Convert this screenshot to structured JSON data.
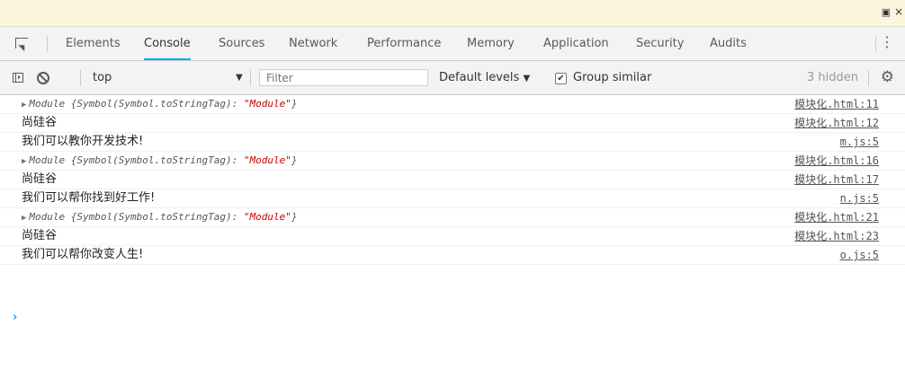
{
  "window": {
    "undock_icon": "undock-icon",
    "close_glyph": "×"
  },
  "tabs": [
    {
      "label": "Elements",
      "active": false
    },
    {
      "label": "Console",
      "active": true
    },
    {
      "label": "Sources",
      "active": false
    },
    {
      "label": "Network",
      "active": false
    },
    {
      "label": "Performance",
      "active": false
    },
    {
      "label": "Memory",
      "active": false
    },
    {
      "label": "Application",
      "active": false
    },
    {
      "label": "Security",
      "active": false
    },
    {
      "label": "Audits",
      "active": false
    }
  ],
  "toolbar": {
    "context": "top",
    "filter_placeholder": "Filter",
    "levels": "Default levels",
    "group_similar": "Group similar",
    "group_similar_checked": true,
    "hidden": "3 hidden"
  },
  "messages": [
    {
      "type": "object",
      "prefix": "Module {Symbol(Symbol.toStringTag): ",
      "value": "\"Module\"",
      "suffix": "}",
      "source": "模块化.html:11"
    },
    {
      "type": "text",
      "text": "尚硅谷",
      "source": "模块化.html:12"
    },
    {
      "type": "text",
      "text": "我们可以教你开发技术!",
      "source": "m.js:5"
    },
    {
      "type": "object",
      "prefix": "Module {Symbol(Symbol.toStringTag): ",
      "value": "\"Module\"",
      "suffix": "}",
      "source": "模块化.html:16"
    },
    {
      "type": "text",
      "text": "尚硅谷",
      "source": "模块化.html:17"
    },
    {
      "type": "text",
      "text": "我们可以帮你找到好工作!",
      "source": "n.js:5"
    },
    {
      "type": "object",
      "prefix": "Module {Symbol(Symbol.toStringTag): ",
      "value": "\"Module\"",
      "suffix": "}",
      "source": "模块化.html:21"
    },
    {
      "type": "text",
      "text": "尚硅谷",
      "source": "模块化.html:23"
    },
    {
      "type": "text",
      "text": "我们可以帮你改变人生!",
      "source": "o.js:5"
    }
  ],
  "prompt": "›"
}
